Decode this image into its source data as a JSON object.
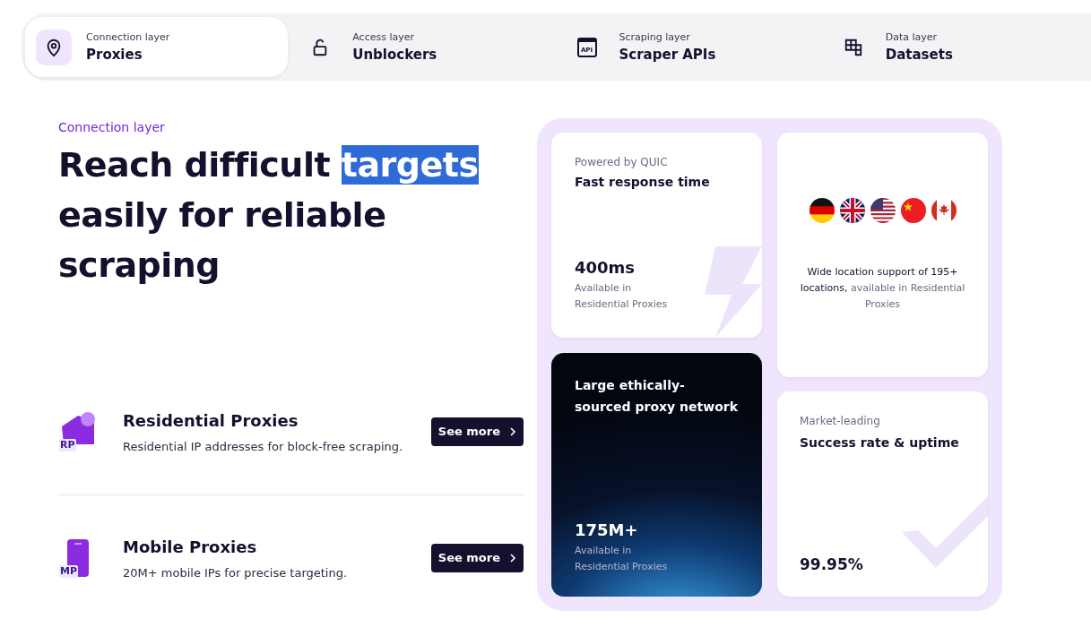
{
  "tabs": [
    {
      "kind": "pin",
      "layer": "Connection layer",
      "label": "Proxies",
      "selected": true
    },
    {
      "kind": "lock",
      "layer": "Access layer",
      "label": "Unblockers",
      "selected": false
    },
    {
      "kind": "api",
      "layer": "Scraping layer",
      "label": "Scraper APIs",
      "selected": false,
      "icon_text": "API"
    },
    {
      "kind": "grid",
      "layer": "Data layer",
      "label": "Datasets",
      "selected": false
    }
  ],
  "hero": {
    "eyebrow": "Connection layer",
    "headline_before": "Reach difficult ",
    "headline_highlighted": "targets",
    "headline_after": " easily for reliable scraping"
  },
  "products": [
    {
      "kind": "residential",
      "badge": "RP",
      "title": "Residential Proxies",
      "description": "Residential IP addresses for block-free scraping.",
      "button": "See more"
    },
    {
      "kind": "mobile",
      "badge": "MP",
      "title": "Mobile Proxies",
      "description": "20M+ mobile IPs for precise targeting.",
      "button": "See more"
    }
  ],
  "feature_cards": {
    "speed": {
      "eyebrow": "Powered by QUIC",
      "title": "Fast response time",
      "value": "400ms",
      "note": "Available in\nResidential Proxies"
    },
    "locations": {
      "flags": [
        {
          "kind": "germany"
        },
        {
          "kind": "uk"
        },
        {
          "kind": "usa"
        },
        {
          "kind": "china"
        },
        {
          "kind": "canada"
        }
      ],
      "text_strong": "Wide location support of 195+ locations,",
      "text_muted": " available in Residential Proxies"
    },
    "network": {
      "title": "Large ethically-sourced proxy network",
      "value": "175M+",
      "note": "Available in\nResidential Proxies"
    },
    "uptime": {
      "eyebrow": "Market-leading",
      "title": "Success rate & uptime",
      "value": "99.95%"
    }
  }
}
